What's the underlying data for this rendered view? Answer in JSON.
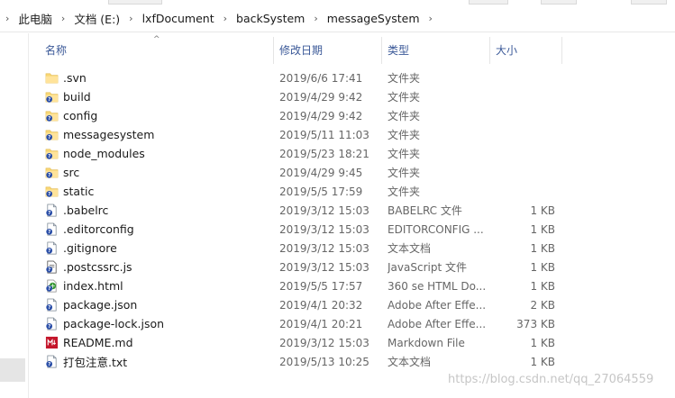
{
  "breadcrumb": [
    "此电脑",
    "文档 (E:)",
    "lxfDocument",
    "backSystem",
    "messageSystem"
  ],
  "columns": {
    "name": "名称",
    "date": "修改日期",
    "type": "类型",
    "size": "大小"
  },
  "files": [
    {
      "name": ".svn",
      "date": "2019/6/6 17:41",
      "type": "文件夹",
      "size": "",
      "icon": "folder-plain-icon"
    },
    {
      "name": "build",
      "date": "2019/4/29 9:42",
      "type": "文件夹",
      "size": "",
      "icon": "folder-svn-icon"
    },
    {
      "name": "config",
      "date": "2019/4/29 9:42",
      "type": "文件夹",
      "size": "",
      "icon": "folder-svn-icon"
    },
    {
      "name": "messagesystem",
      "date": "2019/5/11 11:03",
      "type": "文件夹",
      "size": "",
      "icon": "folder-svn-icon"
    },
    {
      "name": "node_modules",
      "date": "2019/5/23 18:21",
      "type": "文件夹",
      "size": "",
      "icon": "folder-svn-icon"
    },
    {
      "name": "src",
      "date": "2019/4/29 9:45",
      "type": "文件夹",
      "size": "",
      "icon": "folder-svn-icon"
    },
    {
      "name": "static",
      "date": "2019/5/5 17:59",
      "type": "文件夹",
      "size": "",
      "icon": "folder-svn-icon"
    },
    {
      "name": ".babelrc",
      "date": "2019/3/12 15:03",
      "type": "BABELRC 文件",
      "size": "1 KB",
      "icon": "file-svn-icon"
    },
    {
      "name": ".editorconfig",
      "date": "2019/3/12 15:03",
      "type": "EDITORCONFIG ...",
      "size": "1 KB",
      "icon": "file-svn-icon"
    },
    {
      "name": ".gitignore",
      "date": "2019/3/12 15:03",
      "type": "文本文档",
      "size": "1 KB",
      "icon": "file-svn-icon"
    },
    {
      "name": ".postcssrc.js",
      "date": "2019/3/12 15:03",
      "type": "JavaScript 文件",
      "size": "1 KB",
      "icon": "js-file-icon"
    },
    {
      "name": "index.html",
      "date": "2019/5/5 17:57",
      "type": "360 se HTML Do...",
      "size": "1 KB",
      "icon": "html-file-icon"
    },
    {
      "name": "package.json",
      "date": "2019/4/1 20:32",
      "type": "Adobe After Effe...",
      "size": "2 KB",
      "icon": "file-svn-icon"
    },
    {
      "name": "package-lock.json",
      "date": "2019/4/1 20:21",
      "type": "Adobe After Effe...",
      "size": "373 KB",
      "icon": "file-svn-icon"
    },
    {
      "name": "README.md",
      "date": "2019/3/12 15:03",
      "type": "Markdown File",
      "size": "1 KB",
      "icon": "markdown-file-icon"
    },
    {
      "name": "打包注意.txt",
      "date": "2019/5/13 10:25",
      "type": "文本文档",
      "size": "1 KB",
      "icon": "file-svn-icon"
    }
  ],
  "watermark": "https://blog.csdn.net/qq_27064559"
}
